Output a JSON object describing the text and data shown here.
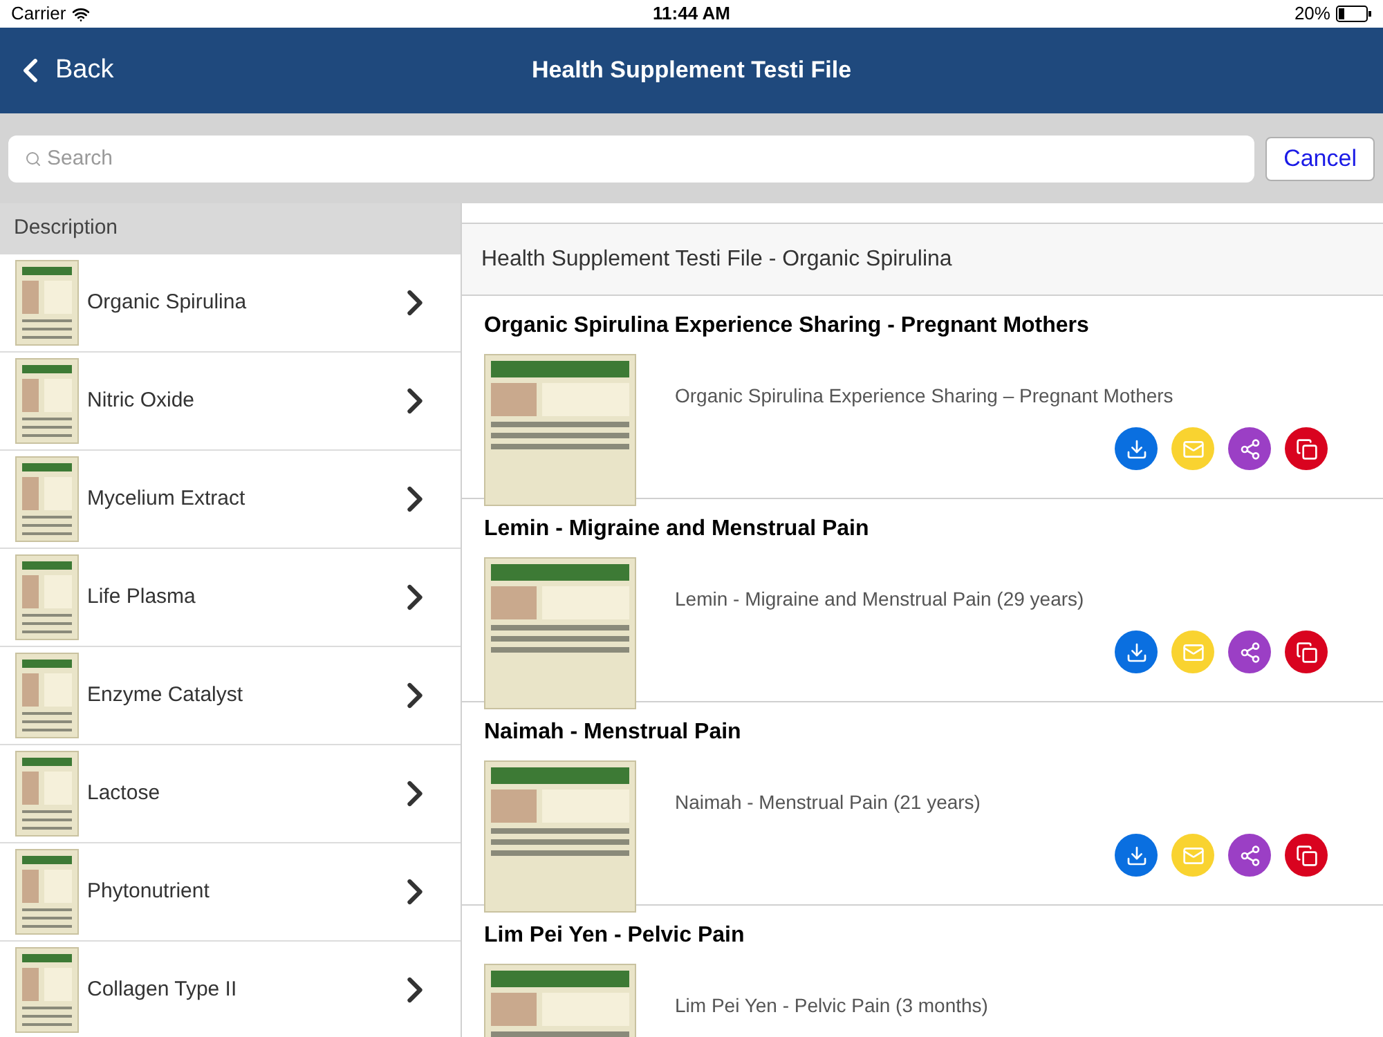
{
  "status_bar": {
    "carrier": "Carrier",
    "time": "11:44 AM",
    "battery": "20%"
  },
  "nav_bar": {
    "back": "Back",
    "title": "Health Supplement Testi File"
  },
  "search": {
    "placeholder": "Search",
    "cancel": "Cancel"
  },
  "sidebar": {
    "header": "Description",
    "items": [
      {
        "label": "Organic Spirulina"
      },
      {
        "label": "Nitric Oxide"
      },
      {
        "label": "Mycelium Extract"
      },
      {
        "label": "Life Plasma"
      },
      {
        "label": "Enzyme Catalyst"
      },
      {
        "label": "Lactose"
      },
      {
        "label": "Phytonutrient"
      },
      {
        "label": "Collagen Type II"
      }
    ]
  },
  "content": {
    "header": "Health Supplement Testi File - Organic Spirulina",
    "items": [
      {
        "title": "Organic Spirulina Experience Sharing - Pregnant Mothers",
        "subtitle": "Organic Spirulina Experience Sharing – Pregnant Mothers"
      },
      {
        "title": "Lemin - Migraine and Menstrual Pain",
        "subtitle": "Lemin - Migraine and Menstrual Pain (29 years)"
      },
      {
        "title": "Naimah - Menstrual Pain",
        "subtitle": "Naimah - Menstrual Pain (21 years)"
      },
      {
        "title": "Lim Pei Yen - Pelvic Pain",
        "subtitle": "Lim Pei Yen - Pelvic Pain (3 months)"
      }
    ]
  }
}
